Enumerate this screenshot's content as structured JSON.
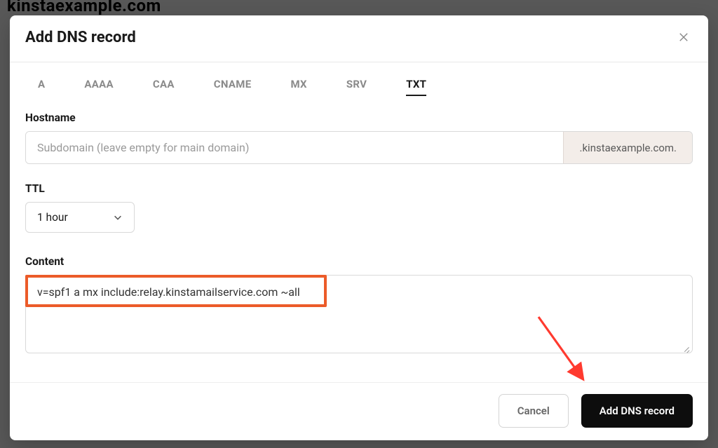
{
  "background": {
    "domain_text": "kinstaexample.com"
  },
  "modal": {
    "title": "Add DNS record",
    "tabs": [
      "A",
      "AAAA",
      "CAA",
      "CNAME",
      "MX",
      "SRV",
      "TXT"
    ],
    "active_tab": "TXT"
  },
  "form": {
    "hostname": {
      "label": "Hostname",
      "placeholder": "Subdomain (leave empty for main domain)",
      "suffix": ".kinstaexample.com."
    },
    "ttl": {
      "label": "TTL",
      "value": "1 hour"
    },
    "content": {
      "label": "Content",
      "value": "v=spf1 a mx include:relay.kinstamailservice.com ~all"
    }
  },
  "footer": {
    "cancel": "Cancel",
    "submit": "Add DNS record"
  },
  "annotations": {
    "highlight_color": "#ec5b29",
    "arrow_color": "#ff3a2f"
  }
}
